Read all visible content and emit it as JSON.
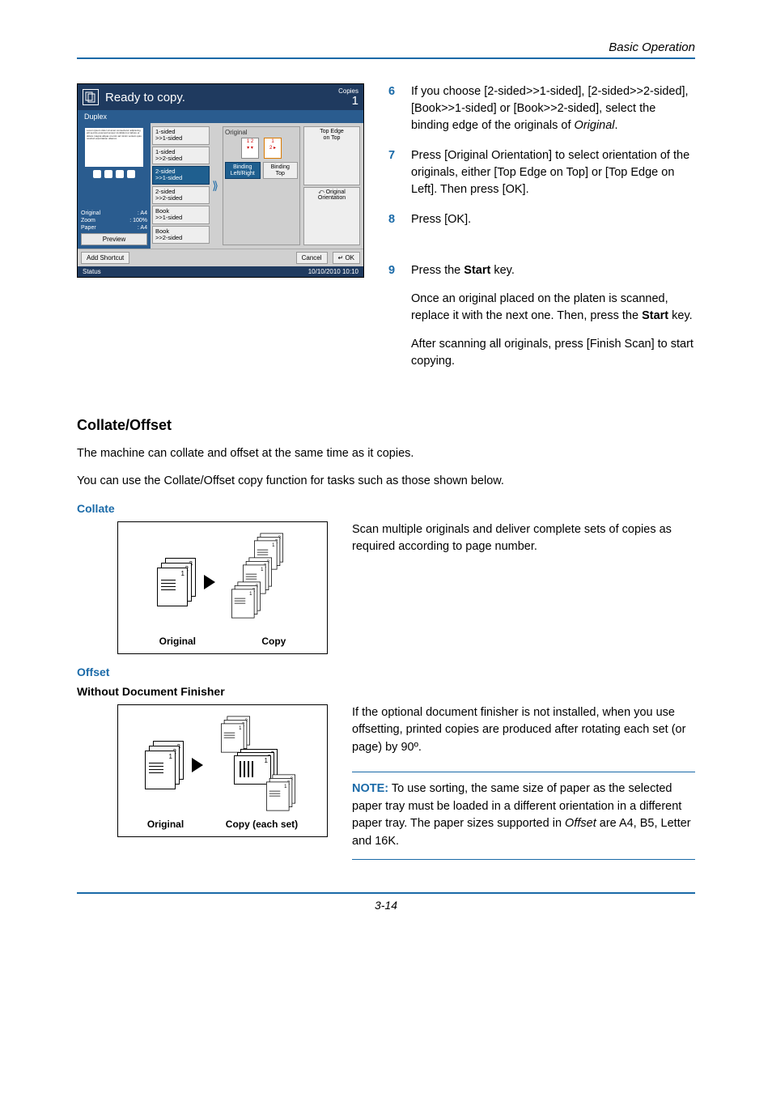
{
  "header": {
    "title": "Basic Operation"
  },
  "panel": {
    "title": "Ready to copy.",
    "copies_label": "Copies",
    "copies_value": "1",
    "subhead": "Duplex",
    "modes": [
      "1-sided\n>>1-sided",
      "1-sided\n>>2-sided",
      "2-sided\n>>1-sided",
      "2-sided\n>>2-sided",
      "Book\n>>1-sided",
      "Book\n>>2-sided"
    ],
    "selected_mode_index": 2,
    "info": {
      "original_label": "Original",
      "original_value": ": A4",
      "zoom_label": "Zoom",
      "zoom_value": ": 100%",
      "paper_label": "Paper",
      "paper_value": ": A4",
      "preview": "Preview"
    },
    "orig_group": {
      "title": "Original",
      "binding_lr": "Binding\nLeft/Right",
      "binding_top": "Binding\nTop"
    },
    "orient": {
      "top_on_top": "Top Edge\non Top",
      "orig_orient": "Original\nOrientation"
    },
    "bottom": {
      "add_shortcut": "Add Shortcut",
      "cancel": "Cancel",
      "ok": "OK"
    },
    "status": {
      "left": "Status",
      "right": "10/10/2010  10:10"
    }
  },
  "steps": {
    "s6": {
      "num": "6",
      "text": "If you choose [2-sided>>1-sided], [2-sided>>2-sided], [Book>>1-sided] or [Book>>2-sided], select the binding edge of the originals of Original."
    },
    "s7": {
      "num": "7",
      "text": "Press [Original Orientation] to select orientation of the originals, either [Top Edge on Top] or [Top Edge on Left]. Then press [OK]."
    },
    "s8": {
      "num": "8",
      "text": "Press [OK]."
    },
    "s9": {
      "num": "9",
      "line1": "Press the Start key.",
      "line2": "Once an original placed on the platen is scanned, replace it with the next one. Then, press the Start key.",
      "line3": "After scanning all originals, press [Finish Scan] to start copying."
    }
  },
  "collate": {
    "heading": "Collate/Offset",
    "intro1": "The machine can collate and offset at the same time as it copies.",
    "intro2": "You can use the Collate/Offset copy function for tasks such as those shown below.",
    "collate_h": "Collate",
    "collate_desc": "Scan multiple originals and deliver complete sets of copies as required according to page number.",
    "dg1": {
      "left": "Original",
      "right": "Copy"
    },
    "offset_h": "Offset",
    "without": "Without Document Finisher",
    "offset_desc": "If the optional document finisher is not installed, when you use offsetting, printed copies are produced after rotating each set (or page) by 90º.",
    "dg2": {
      "left": "Original",
      "right": "Copy (each set)"
    },
    "note_label": "NOTE:",
    "note_text": "To use sorting, the same size of paper as the selected paper tray must be loaded in a different orientation in a different paper tray. The paper sizes supported in Offset are A4, B5, Letter and 16K."
  },
  "footer": {
    "page": "3-14"
  }
}
